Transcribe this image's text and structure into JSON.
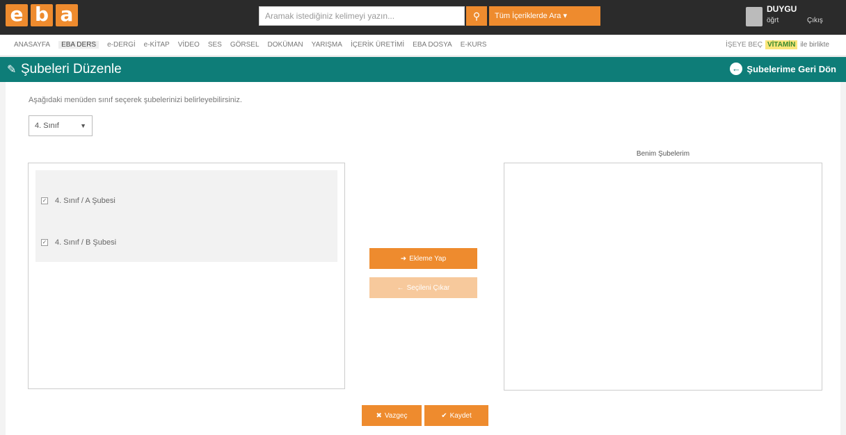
{
  "header": {
    "logo_letters": [
      "e",
      "b",
      "a"
    ],
    "search_placeholder": "Aramak istediğiniz kelimeyi yazın...",
    "search_scope": "Tüm İçeriklerde Ara",
    "user_name": "DUYGU",
    "user_role": "öğrt",
    "user_logout": "Çıkış"
  },
  "nav": {
    "items": [
      "ANASAYFA",
      "EBA DERS",
      "e-DERGİ",
      "e-KİTAP",
      "VİDEO",
      "SES",
      "GÖRSEL",
      "DOKÜMAN",
      "YARIŞMA",
      "İÇERİK ÜRETİMİ",
      "EBA DOSYA",
      "E-KURS"
    ],
    "active_index": 1,
    "right_label": "İŞEYE BEÇ",
    "vitamin": "VİTAMİN",
    "vitamin_sub": "ile birlikte"
  },
  "titlebar": {
    "title": "Şubeleri Düzenle",
    "back_label": "Şubelerime Geri Dön"
  },
  "main": {
    "instruction": "Aşağıdaki menüden sınıf seçerek şubelerinizi belirleyebilirsiniz.",
    "class_select": "4. Sınıf",
    "branches": [
      "4. Sınıf / A Şubesi",
      "4. Sınıf / B Şubesi"
    ],
    "right_title": "Benim Şubelerim",
    "add_button": "Ekleme Yap",
    "remove_button": "Seçileni Çıkar",
    "cancel_button": "Vazgeç",
    "save_button": "Kaydet"
  },
  "colors": {
    "orange": "#ee8b2e",
    "teal": "#0e7d78",
    "dark": "#2b2b2b"
  }
}
